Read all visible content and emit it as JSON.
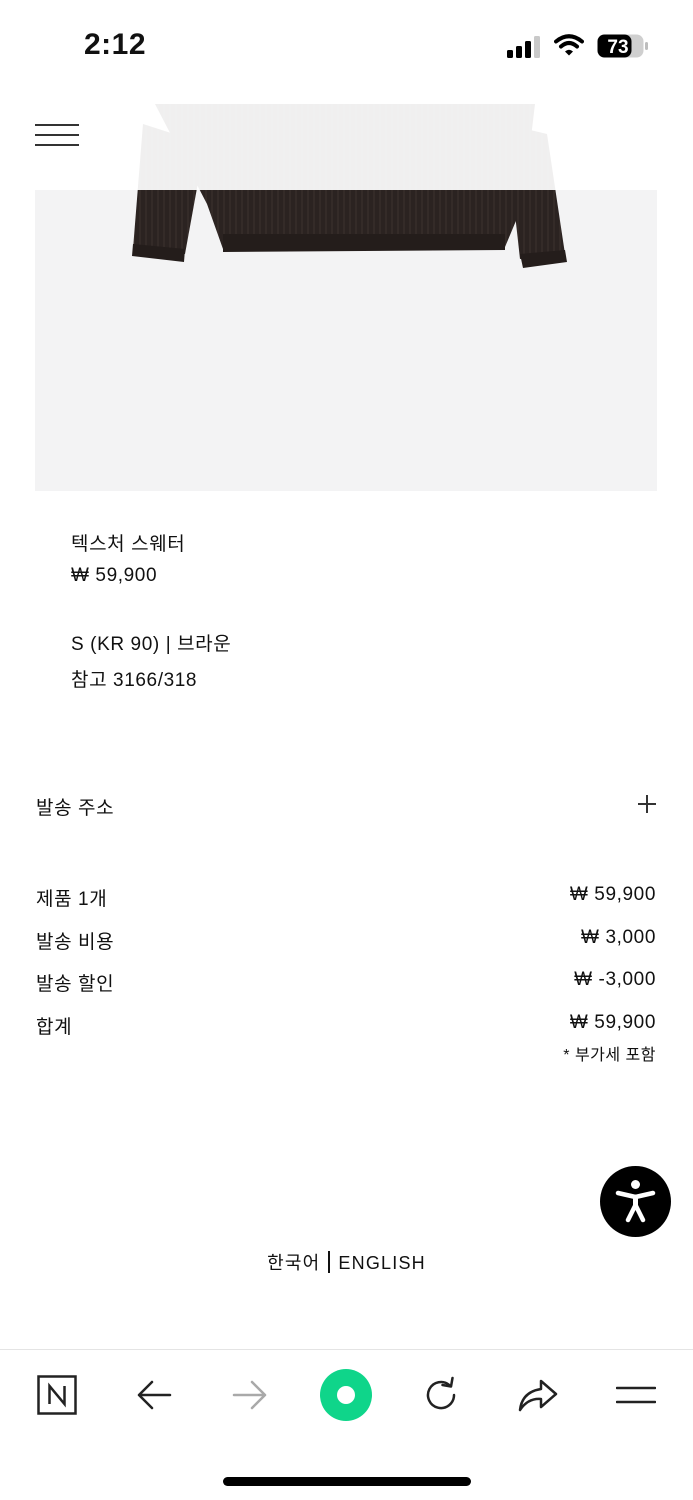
{
  "status_bar": {
    "time": "2:12",
    "battery_level": "73"
  },
  "product": {
    "name": "텍스처 스웨터",
    "price": "₩ 59,900",
    "variant": "S (KR 90) | 브라운",
    "reference": "참고 3166/318",
    "image_icon": "sweater-image"
  },
  "shipping": {
    "address_label": "발송 주소"
  },
  "summary": {
    "rows": [
      {
        "label": "제품 1개",
        "value": "₩ 59,900"
      },
      {
        "label": "발송 비용",
        "value": "₩ 3,000"
      },
      {
        "label": "발송 할인",
        "value": "₩ -3,000"
      },
      {
        "label": "합계",
        "value": "₩ 59,900"
      }
    ],
    "vat_note": "* 부가세 포함"
  },
  "language": {
    "korean": "한국어",
    "english": "ENGLISH"
  },
  "toolbar": {
    "icons": [
      "naver-home-icon",
      "back-arrow-icon",
      "forward-arrow-icon",
      "green-dot-icon",
      "reload-icon",
      "share-icon",
      "menu-icon"
    ]
  },
  "colors": {
    "accent_green": "#0fd58a",
    "text": "#111111",
    "image_bg": "#f3f3f4",
    "sweater": "#2b2321"
  }
}
